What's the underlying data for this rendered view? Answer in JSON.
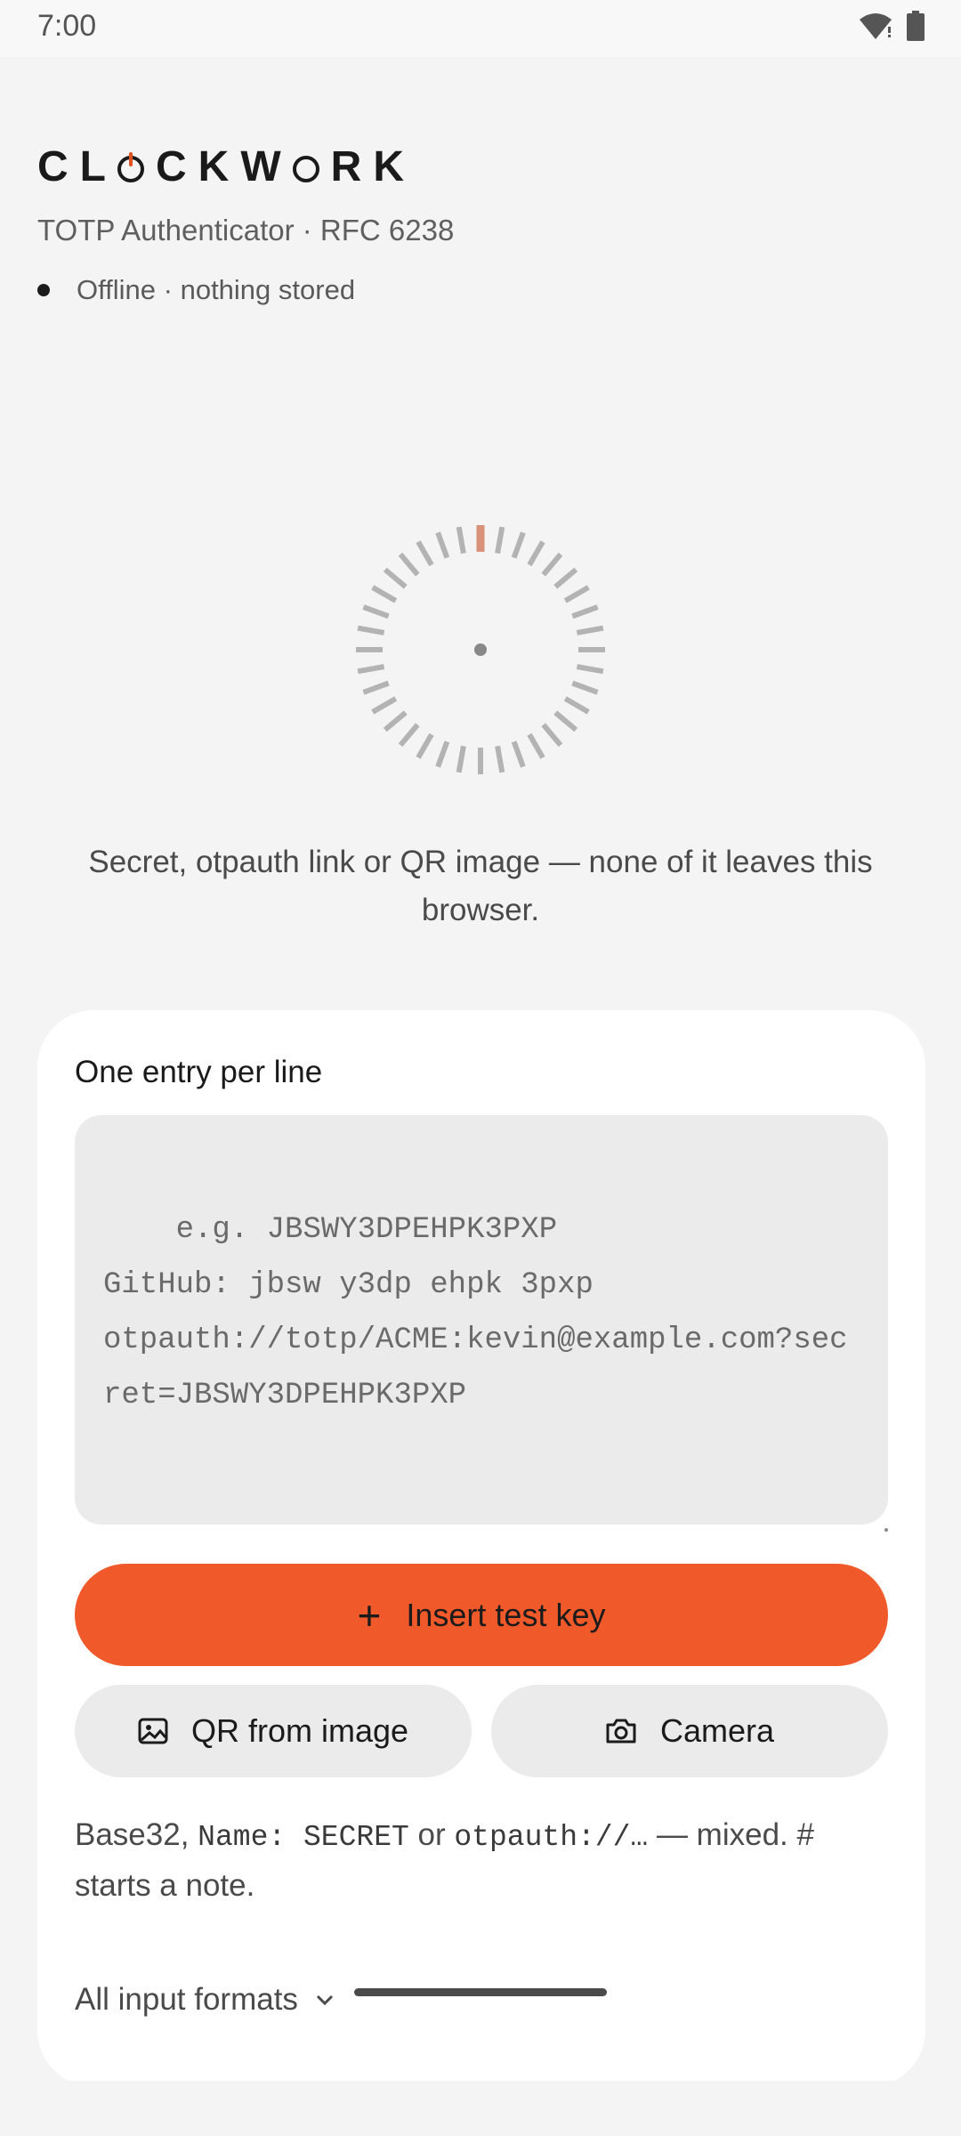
{
  "status_bar": {
    "time": "7:00",
    "wifi_icon": "wifi-alert-icon",
    "battery_icon": "battery-icon"
  },
  "header": {
    "brand_letters": [
      "C",
      "L",
      "C",
      "K",
      "W",
      "R",
      "K"
    ],
    "subtitle": "TOTP Authenticator · RFC 6238",
    "status_text": "Offline · nothing stored"
  },
  "intro_text": "Secret, otpauth link or QR image — none of it leaves this browser.",
  "card": {
    "label": "One entry per line",
    "entry_placeholder": "e.g. JBSWY3DPEHPK3PXP\nGitHub: jbsw y3dp ehpk 3pxp\notpauth://totp/ACME:kevin@example.com?secret=JBSWY3DPEHPK3PXP",
    "insert_button": "Insert test key",
    "qr_button": "QR from image",
    "camera_button": "Camera",
    "hint": {
      "part1": "Base32, ",
      "code1": "Name: SECRET",
      "part2": " or ",
      "code2": "otpauth://…",
      "part3": " — mixed. # starts a note."
    },
    "formats_link": "All input formats"
  },
  "colors": {
    "accent": "#f05a2a",
    "dial_tick": "#b3b3b3",
    "dial_active": "#d9917a"
  }
}
